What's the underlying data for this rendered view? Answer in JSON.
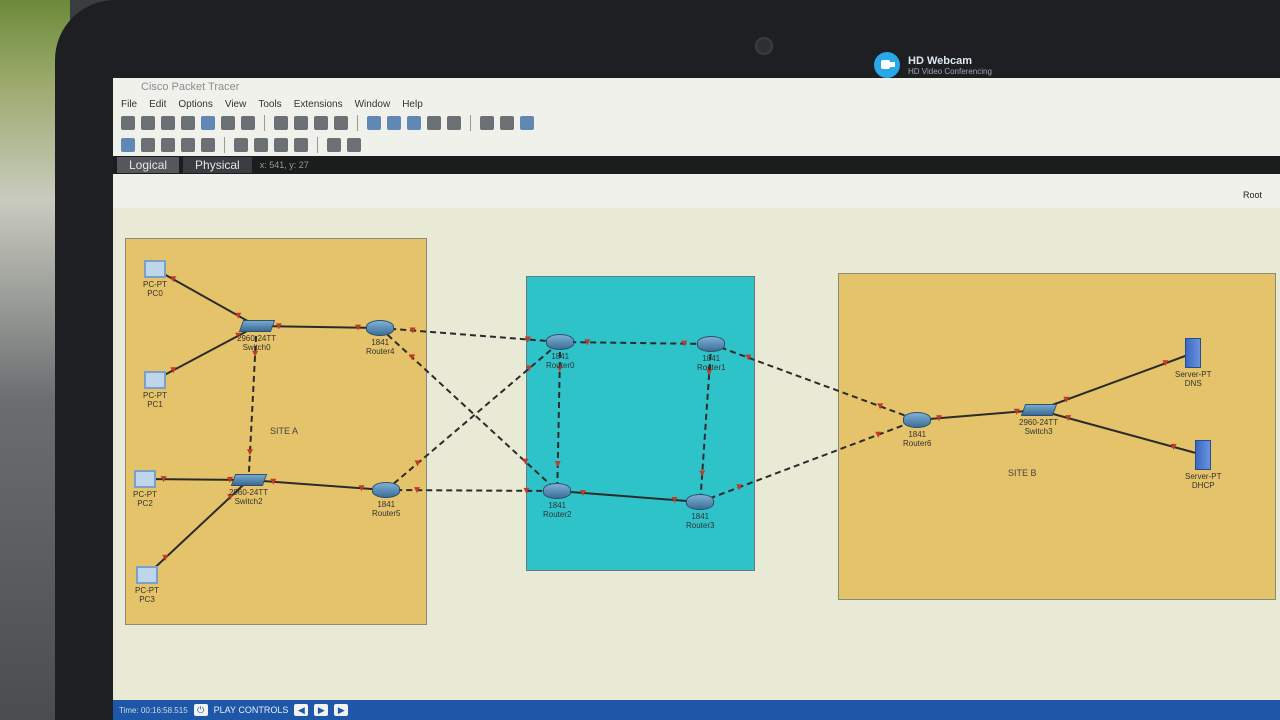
{
  "webcam": {
    "title": "HD Webcam",
    "subtitle": "HD Video Conferencing"
  },
  "app": {
    "title": "Cisco Packet Tracer"
  },
  "menu": [
    "File",
    "Edit",
    "Options",
    "View",
    "Tools",
    "Extensions",
    "Window",
    "Help"
  ],
  "tabs": {
    "logical": "Logical",
    "physical": "Physical",
    "coords": "x: 541, y: 27"
  },
  "workspace": {
    "root_label": "Root"
  },
  "zones": {
    "site_a": "SITE A",
    "site_b": "SITE B"
  },
  "devices": [
    {
      "id": "pc0",
      "type": "pc",
      "model": "PC-PT",
      "name": "PC0"
    },
    {
      "id": "pc1",
      "type": "pc",
      "model": "PC-PT",
      "name": "PC1"
    },
    {
      "id": "pc2",
      "type": "pc",
      "model": "PC-PT",
      "name": "PC2"
    },
    {
      "id": "pc3",
      "type": "pc",
      "model": "PC-PT",
      "name": "PC3"
    },
    {
      "id": "switch0",
      "type": "switch",
      "model": "2960-24TT",
      "name": "Switch0"
    },
    {
      "id": "switch2",
      "type": "switch",
      "model": "2960-24TT",
      "name": "Switch2"
    },
    {
      "id": "switch3",
      "type": "switch",
      "model": "2960-24TT",
      "name": "Switch3"
    },
    {
      "id": "router4",
      "type": "router",
      "model": "1841",
      "name": "Router4"
    },
    {
      "id": "router5",
      "type": "router",
      "model": "1841",
      "name": "Router5"
    },
    {
      "id": "router0",
      "type": "router",
      "model": "1841",
      "name": "Router0"
    },
    {
      "id": "router1",
      "type": "router",
      "model": "1841",
      "name": "Router1"
    },
    {
      "id": "router2",
      "type": "router",
      "model": "1841",
      "name": "Router2"
    },
    {
      "id": "router3",
      "type": "router",
      "model": "1841",
      "name": "Router3"
    },
    {
      "id": "router6",
      "type": "router",
      "model": "1841",
      "name": "Router6"
    },
    {
      "id": "dns",
      "type": "server",
      "model": "Server-PT",
      "name": "DNS"
    },
    {
      "id": "dhcp",
      "type": "server",
      "model": "Server-PT",
      "name": "DHCP"
    }
  ],
  "links": [
    {
      "from": "pc0",
      "to": "switch0",
      "style": "solid"
    },
    {
      "from": "pc1",
      "to": "switch0",
      "style": "solid"
    },
    {
      "from": "pc2",
      "to": "switch2",
      "style": "solid"
    },
    {
      "from": "pc3",
      "to": "switch2",
      "style": "solid"
    },
    {
      "from": "switch0",
      "to": "router4",
      "style": "solid"
    },
    {
      "from": "switch2",
      "to": "router5",
      "style": "solid"
    },
    {
      "from": "switch0",
      "to": "switch2",
      "style": "dashed"
    },
    {
      "from": "router4",
      "to": "router0",
      "style": "dashed"
    },
    {
      "from": "router4",
      "to": "router2",
      "style": "dashed"
    },
    {
      "from": "router5",
      "to": "router0",
      "style": "dashed"
    },
    {
      "from": "router5",
      "to": "router2",
      "style": "dashed"
    },
    {
      "from": "router0",
      "to": "router1",
      "style": "dashed"
    },
    {
      "from": "router0",
      "to": "router2",
      "style": "dashed"
    },
    {
      "from": "router2",
      "to": "router3",
      "style": "solid"
    },
    {
      "from": "router1",
      "to": "router3",
      "style": "dashed"
    },
    {
      "from": "router1",
      "to": "router6",
      "style": "dashed"
    },
    {
      "from": "router3",
      "to": "router6",
      "style": "dashed"
    },
    {
      "from": "router6",
      "to": "switch3",
      "style": "solid"
    },
    {
      "from": "switch3",
      "to": "dns",
      "style": "solid"
    },
    {
      "from": "switch3",
      "to": "dhcp",
      "style": "solid"
    }
  ],
  "statusbar": {
    "time": "Time: 00:16:58.515",
    "play_controls": "PLAY CONTROLS"
  },
  "colors": {
    "site_zone": "#e5c36a",
    "core_zone": "#2ec3c8",
    "link": "#2b2b2b",
    "link_marker": "#c0392b",
    "statusbar": "#1f57a8"
  }
}
